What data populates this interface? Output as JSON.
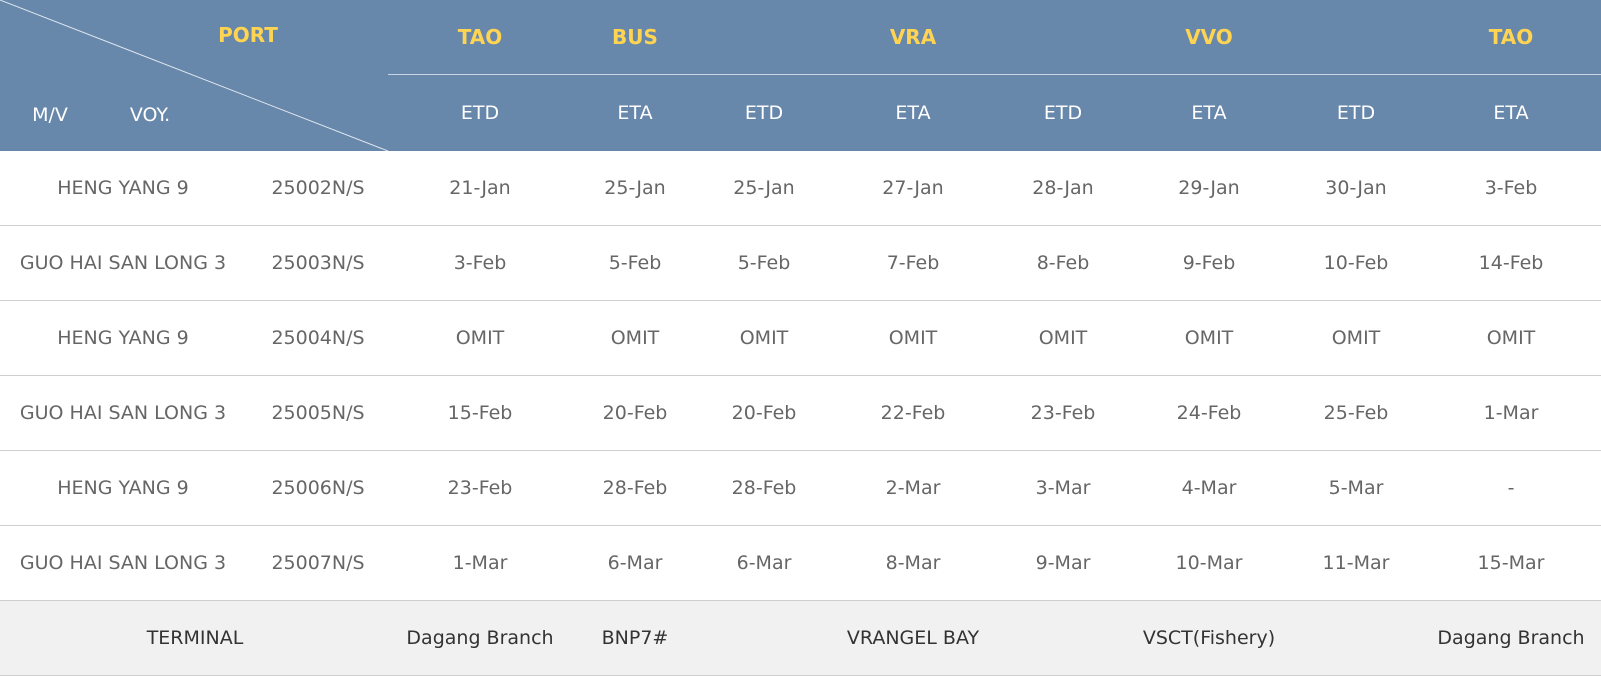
{
  "header": {
    "port_label": "PORT",
    "mv_label": "M/V",
    "voy_label": "VOY.",
    "ports": [
      "TAO",
      "BUS",
      "VRA",
      "VVO",
      "TAO"
    ],
    "subcols": [
      "ETD",
      "ETA",
      "ETD",
      "ETA",
      "ETD",
      "ETA",
      "ETD",
      "ETA"
    ]
  },
  "rows": [
    {
      "vessel": "HENG YANG 9",
      "voyage": "25002N/S",
      "dates": [
        "21-Jan",
        "25-Jan",
        "25-Jan",
        "27-Jan",
        "28-Jan",
        "29-Jan",
        "30-Jan",
        "3-Feb"
      ]
    },
    {
      "vessel": "GUO HAI SAN LONG 3",
      "voyage": "25003N/S",
      "dates": [
        "3-Feb",
        "5-Feb",
        "5-Feb",
        "7-Feb",
        "8-Feb",
        "9-Feb",
        "10-Feb",
        "14-Feb"
      ]
    },
    {
      "vessel": "HENG YANG 9",
      "voyage": "25004N/S",
      "dates": [
        "OMIT",
        "OMIT",
        "OMIT",
        "OMIT",
        "OMIT",
        "OMIT",
        "OMIT",
        "OMIT"
      ]
    },
    {
      "vessel": "GUO HAI SAN LONG 3",
      "voyage": "25005N/S",
      "dates": [
        "15-Feb",
        "20-Feb",
        "20-Feb",
        "22-Feb",
        "23-Feb",
        "24-Feb",
        "25-Feb",
        "1-Mar"
      ]
    },
    {
      "vessel": "HENG YANG 9",
      "voyage": "25006N/S",
      "dates": [
        "23-Feb",
        "28-Feb",
        "28-Feb",
        "2-Mar",
        "3-Mar",
        "4-Mar",
        "5-Mar",
        "-"
      ]
    },
    {
      "vessel": "GUO HAI SAN LONG 3",
      "voyage": "25007N/S",
      "dates": [
        "1-Mar",
        "6-Mar",
        "6-Mar",
        "8-Mar",
        "9-Mar",
        "10-Mar",
        "11-Mar",
        "15-Mar"
      ]
    }
  ],
  "terminal": {
    "label": "TERMINAL",
    "names": [
      "Dagang Branch",
      "BNP7#",
      "VRANGEL BAY",
      "VSCT(Fishery)",
      "Dagang Branch"
    ]
  },
  "colors": {
    "header_bg": "#6787ab",
    "port_code": "#ffd452",
    "header_text": "#ffffff",
    "body_text": "#666666",
    "terminal_bg": "#f1f1f1"
  }
}
